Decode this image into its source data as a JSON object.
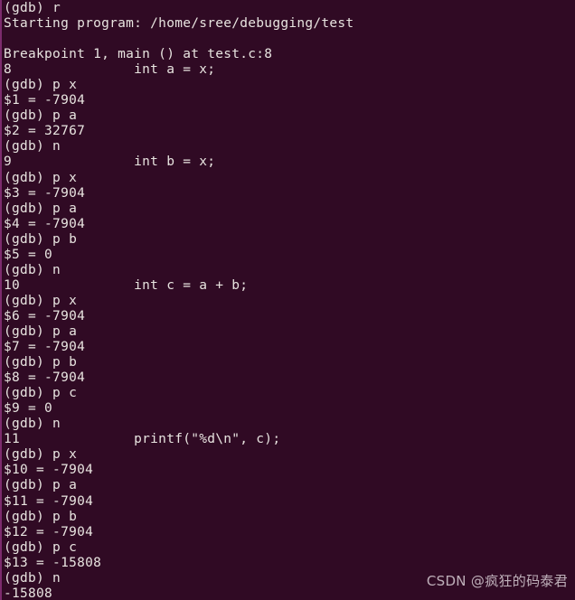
{
  "terminal": {
    "app": "gdb-session-terminal",
    "colors": {
      "background": "#300a24",
      "foreground": "#e8e4e0",
      "left_border": "#7c2b6e",
      "watermark": "#e2d8de"
    },
    "lines": [
      "(gdb) r",
      "Starting program: /home/sree/debugging/test",
      "",
      "Breakpoint 1, main () at test.c:8",
      "8\t        int a = x;",
      "(gdb) p x",
      "$1 = -7904",
      "(gdb) p a",
      "$2 = 32767",
      "(gdb) n",
      "9\t        int b = x;",
      "(gdb) p x",
      "$3 = -7904",
      "(gdb) p a",
      "$4 = -7904",
      "(gdb) p b",
      "$5 = 0",
      "(gdb) n",
      "10\t        int c = a + b;",
      "(gdb) p x",
      "$6 = -7904",
      "(gdb) p a",
      "$7 = -7904",
      "(gdb) p b",
      "$8 = -7904",
      "(gdb) p c",
      "$9 = 0",
      "(gdb) n",
      "11\t        printf(\"%d\\n\", c);",
      "(gdb) p x",
      "$10 = -7904",
      "(gdb) p a",
      "$11 = -7904",
      "(gdb) p b",
      "$12 = -7904",
      "(gdb) p c",
      "$13 = -15808",
      "(gdb) n",
      "-15808"
    ]
  },
  "watermark": {
    "text": "CSDN @疯狂的码泰君"
  }
}
